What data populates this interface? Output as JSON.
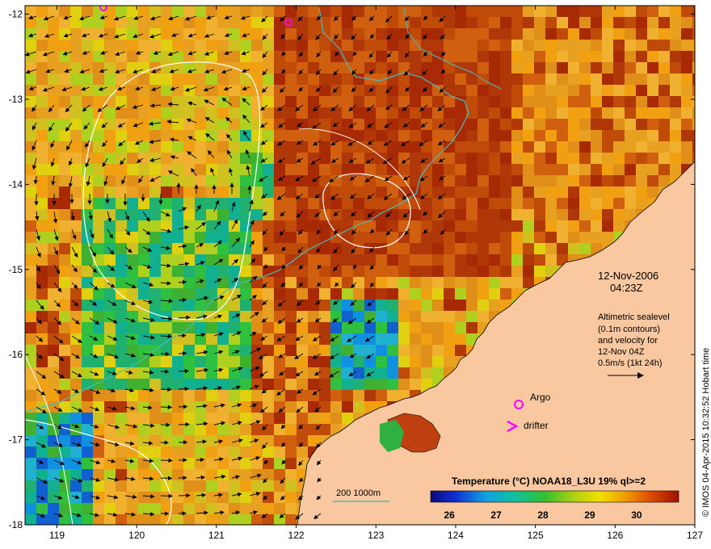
{
  "map": {
    "date_label": "12-Nov-2006",
    "time_label": "04:23Z",
    "altimetry_lines": [
      "Altimetric sealevel",
      "(0.1m contours)",
      "and velocity for",
      "12-Nov 04Z",
      "0.5m/s (1kt 24h)"
    ],
    "legend_argo": "Argo",
    "legend_drifter": "drifter",
    "depth_legend": "200  1000m",
    "colorbar_title": "Temperature (°C) NOAA18_L3U 19% ql>=2",
    "colorbar_ticks": [
      "26",
      "27",
      "28",
      "29",
      "30"
    ],
    "credit": "© IMOS 04-Apr-2015 10:32:52 Hobart time",
    "x_ticks": [
      "119",
      "120",
      "121",
      "122",
      "123",
      "124",
      "125",
      "126",
      "127"
    ],
    "y_ticks": [
      "-12",
      "-13",
      "-14",
      "-15",
      "-16",
      "-17",
      "-18"
    ],
    "lon_range": [
      118.6,
      127
    ],
    "lat_range": [
      -18,
      -11.9
    ],
    "colors": {
      "land": "#f9c8a0",
      "argo": "#ff00ff",
      "depth_contour": "#40c0c0",
      "sealevel_contour": "#ffffff"
    }
  }
}
